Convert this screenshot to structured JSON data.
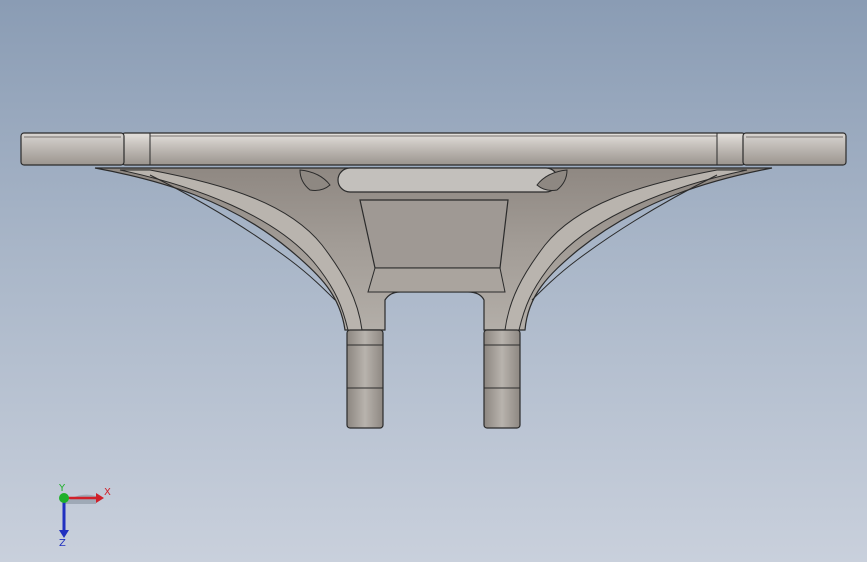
{
  "viewport": {
    "background_top": "#8a9cb4",
    "background_bottom": "#c9d0dc",
    "part_color": "#a9a49e",
    "edge_color": "#2b2b2b"
  },
  "triad": {
    "x_label": "X",
    "y_label": "Y",
    "z_label": "Z",
    "x_color": "#d0202a",
    "y_color": "#1fb02a",
    "z_color": "#2030c0"
  }
}
